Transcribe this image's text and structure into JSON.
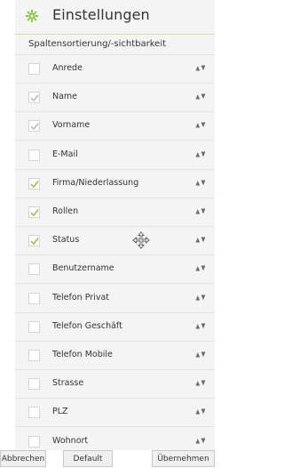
{
  "header": {
    "title": "Einstellungen",
    "icon": "gear-icon",
    "accent": "#8dc63f"
  },
  "subheader": {
    "label": "Spaltensortierung/-sichtbarkeit"
  },
  "columns": [
    {
      "label": "Anrede",
      "checked": false,
      "locked": false
    },
    {
      "label": "Name",
      "checked": true,
      "locked": true
    },
    {
      "label": "Vorname",
      "checked": true,
      "locked": true
    },
    {
      "label": "E-Mail",
      "checked": false,
      "locked": false
    },
    {
      "label": "Firma/Niederlassung",
      "checked": true,
      "locked": false
    },
    {
      "label": "Rollen",
      "checked": true,
      "locked": false
    },
    {
      "label": "Status",
      "checked": true,
      "locked": false
    },
    {
      "label": "Benutzername",
      "checked": false,
      "locked": false
    },
    {
      "label": "Telefon Privat",
      "checked": false,
      "locked": false
    },
    {
      "label": "Telefon Geschäft",
      "checked": false,
      "locked": false
    },
    {
      "label": "Telefon Mobile",
      "checked": false,
      "locked": false
    },
    {
      "label": "Strasse",
      "checked": false,
      "locked": false
    },
    {
      "label": "PLZ",
      "checked": false,
      "locked": false
    },
    {
      "label": "Wohnort",
      "checked": false,
      "locked": false
    }
  ],
  "footer": {
    "cancel_label": "Abbrechen",
    "default_label": "Default",
    "apply_label": "Übernehmen"
  },
  "colors": {
    "check_active": "#8dc63f",
    "check_locked": "#b8b8b8",
    "sort_icon": "#6a6a6a"
  }
}
